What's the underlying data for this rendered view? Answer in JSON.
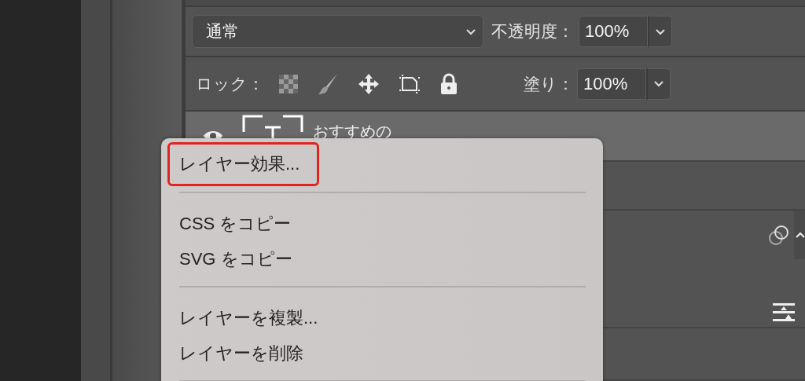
{
  "blend_mode": {
    "value": "通常"
  },
  "opacity": {
    "label": "不透明度：",
    "value": "100%"
  },
  "lock": {
    "label": "ロック："
  },
  "fill": {
    "label": "塗り：",
    "value": "100%"
  },
  "layer": {
    "name": "おすすめの",
    "selected": true
  },
  "context_menu": {
    "groups": [
      [
        {
          "label": "レイヤー効果...",
          "highlighted": true
        }
      ],
      [
        {
          "label": "CSS をコピー",
          "highlighted": false
        },
        {
          "label": "SVG をコピー",
          "highlighted": false
        }
      ],
      [
        {
          "label": "レイヤーを複製...",
          "highlighted": false
        },
        {
          "label": "レイヤーを削除",
          "highlighted": false
        }
      ]
    ]
  }
}
